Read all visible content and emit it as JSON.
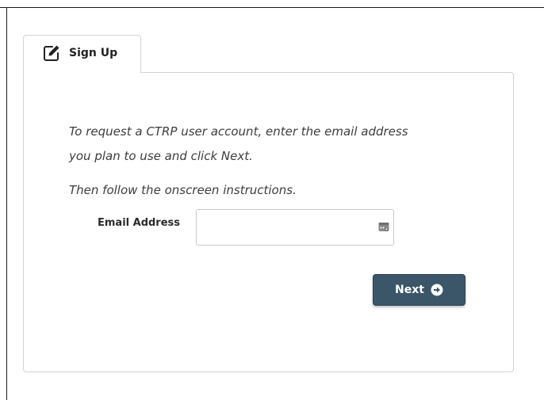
{
  "tab": {
    "label": "Sign Up",
    "icon": "edit-icon"
  },
  "instructions": {
    "line1": "To request a CTRP user account, enter the email address",
    "line2": "you plan to use and click Next.",
    "line3": "Then follow the onscreen instructions."
  },
  "form": {
    "email_label": "Email Address",
    "email_value": "",
    "email_placeholder": "",
    "autofill_icon": "contact-card-icon"
  },
  "actions": {
    "next_label": "Next",
    "next_icon": "arrow-circle-right-icon"
  },
  "colors": {
    "button_bg": "#3a5668",
    "border": "#cfd4d8",
    "text": "#3d3d3d"
  }
}
